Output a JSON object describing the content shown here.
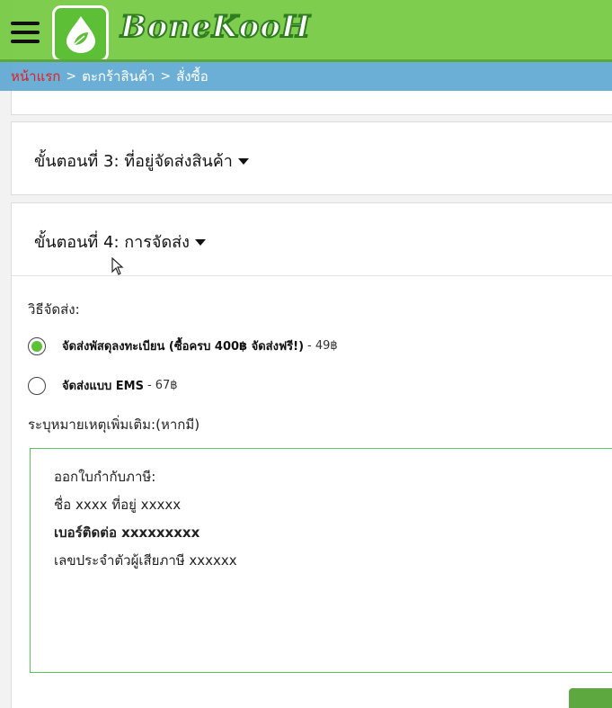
{
  "header": {
    "logo_text": "BoneKooH"
  },
  "breadcrumb": {
    "home": "หน้าแรก",
    "cart": "ตะกร้าสินค้า",
    "order": "สั่งซื้อ",
    "separator": ">"
  },
  "step3": {
    "title": "ขั้นตอนที่ 3: ที่อยู่จัดส่งสินค้า"
  },
  "step4": {
    "title": "ขั้นตอนที่ 4: การจัดส่ง",
    "method_label": "วิธีจัดส่ง:",
    "options": [
      {
        "name": "จัดส่งพัสดุลงทะเบียน (ซื้อครบ 400฿ จัดส่งฟรี!)",
        "price": "- 49฿",
        "selected": true
      },
      {
        "name": "จัดส่งแบบ EMS",
        "price": "- 67฿",
        "selected": false
      }
    ],
    "note_label": "ระบุหมายเหตุเพิ่มเติม:(หากมี)",
    "note_lines": [
      "ออกใบกำกับภาษี:",
      "ชื่อ xxxx ที่อยู่ xxxxx",
      "เบอร์ติดต่อ  xxxxxxxxx",
      "เลขประจำตัวผู้เสียภาษี xxxxxx"
    ]
  },
  "colors": {
    "header_green": "#70c83c",
    "breadcrumb_blue": "#60a8d2",
    "radio_selected": "#5bc236",
    "note_border": "#5cc45a"
  },
  "icons": {
    "menu": "hamburger-icon",
    "logo": "water-drop-leaf-icon",
    "caret": "caret-down-icon"
  }
}
